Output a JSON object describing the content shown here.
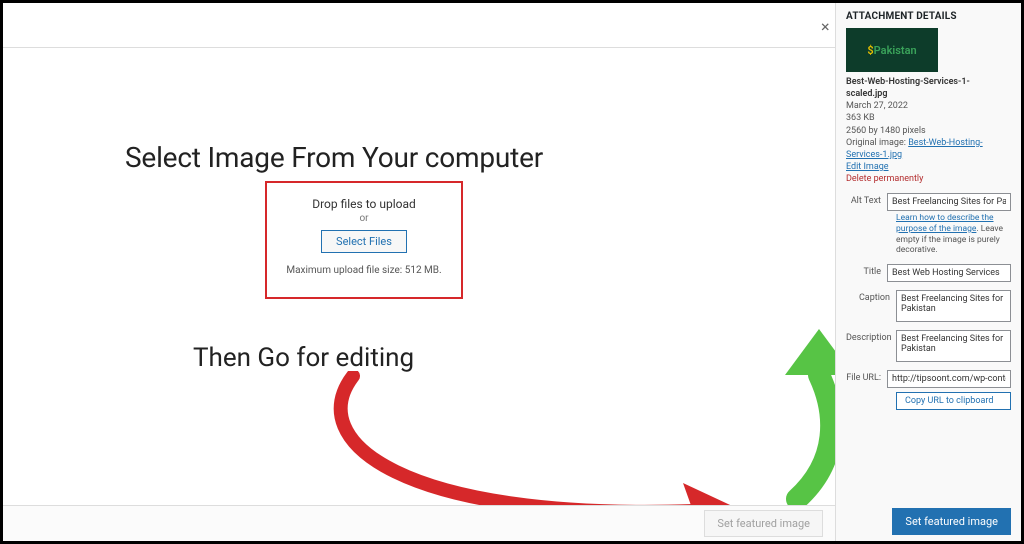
{
  "main": {
    "heading1": "Select Image From Your computer",
    "heading2": "Then Go for editing",
    "drop": {
      "title": "Drop files to upload",
      "or": "or",
      "select": "Select Files",
      "max": "Maximum upload file size: 512 MB."
    },
    "disabled_button": "Set featured image",
    "close": "×"
  },
  "panel": {
    "title": "ATTACHMENT DETAILS",
    "thumb": {
      "dollar": "$",
      "rest": "Pakistan"
    },
    "filename": "Best-Web-Hosting-Services-1-scaled.jpg",
    "date": "March 27, 2022",
    "size": "363 KB",
    "dims": "2560 by 1480 pixels",
    "orig_label": "Original image:",
    "orig_link": "Best-Web-Hosting-Services-1.jpg",
    "edit": "Edit Image",
    "delete": "Delete permanently",
    "fields": {
      "alt_label": "Alt Text",
      "alt_value": "Best Freelancing Sites for Pakistan",
      "alt_hint_link": "Learn how to describe the purpose of the image",
      "alt_hint_rest": ". Leave empty if the image is purely decorative.",
      "title_label": "Title",
      "title_value": "Best Web Hosting Services",
      "caption_label": "Caption",
      "caption_value": "Best Freelancing Sites for Pakistan",
      "desc_label": "Description",
      "desc_value": "Best Freelancing Sites for Pakistan",
      "url_label": "File URL:",
      "url_value": "http://tipsoont.com/wp-content",
      "copy": "Copy URL to clipboard"
    },
    "set_button": "Set featured image"
  }
}
